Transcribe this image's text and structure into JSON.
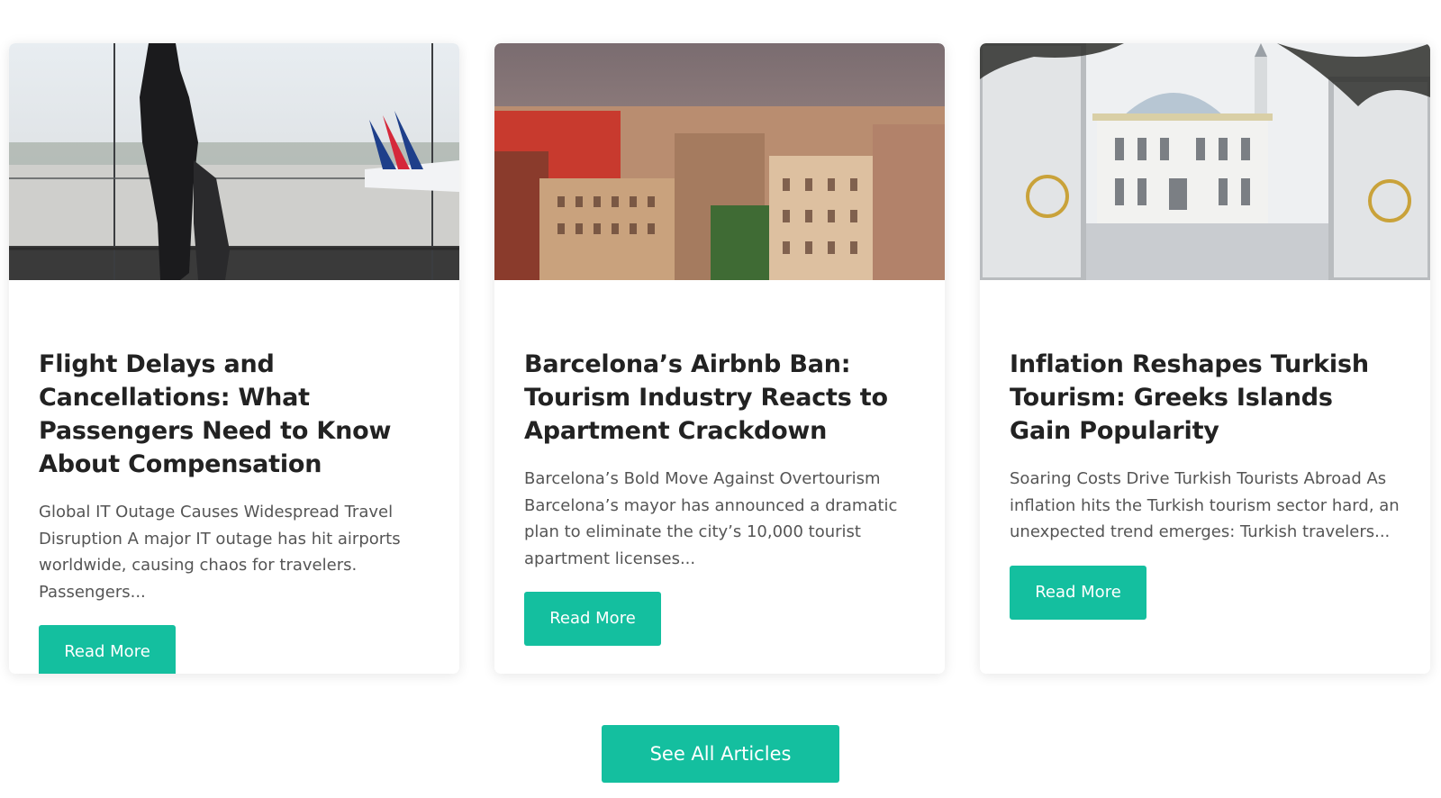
{
  "articles": [
    {
      "image_alt": "Traveler silhouette at airport window with airplane",
      "title": "Flight Delays and Cancellations: What Passengers Need to Know About Compensation",
      "excerpt": "Global IT Outage Causes Widespread Travel Disruption A major IT outage has hit airports worldwide, causing chaos for travelers. Passengers...",
      "button_label": "Read More"
    },
    {
      "image_alt": "Barcelona city rooftops and apartment buildings",
      "title": "Barcelona’s Airbnb Ban: Tourism Industry Reacts to Apartment Crackdown",
      "excerpt": "Barcelona’s Bold Move Against Overtourism Barcelona’s mayor has announced a dramatic plan to eliminate the city’s 10,000 tourist apartment licenses...",
      "button_label": "Read More"
    },
    {
      "image_alt": "White mosque seen through ornate gates",
      "title": "Inflation Reshapes Turkish Tourism: Greeks Islands Gain Popularity",
      "excerpt": "Soaring Costs Drive Turkish Tourists Abroad As inflation hits the Turkish tourism sector hard, an unexpected trend emerges: Turkish travelers...",
      "button_label": "Read More"
    }
  ],
  "see_all_label": "See All Articles",
  "colors": {
    "accent": "#14bf9f",
    "title": "#222222",
    "excerpt": "#555555"
  }
}
